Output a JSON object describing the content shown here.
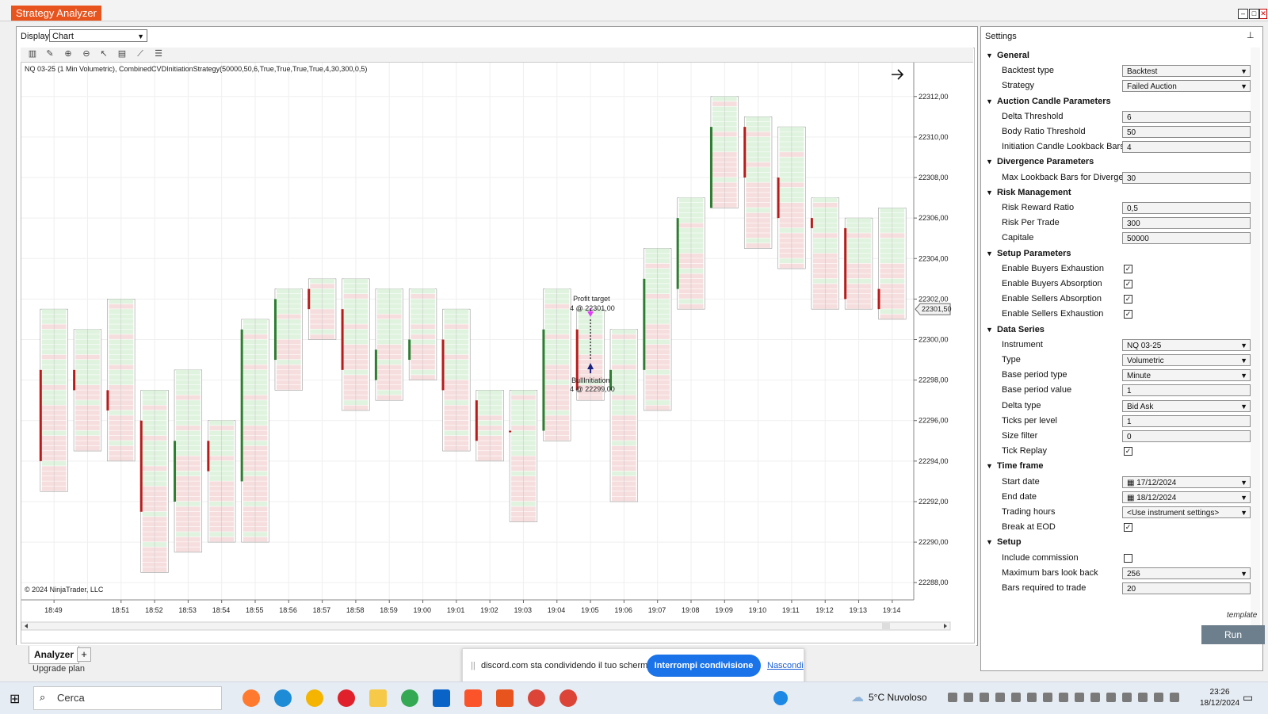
{
  "window": {
    "title": "Strategy Analyzer"
  },
  "display": {
    "label": "Display",
    "value": "Chart"
  },
  "chart": {
    "info": "NQ 03-25 (1 Min Volumetric), CombinedCVDInitiationStrategy(50000,50,6,True,True,True,True,4,30,300,0,5)",
    "copyright": "© 2024 NinjaTrader, LLC",
    "y_ticks": [
      "22312,00",
      "22310,00",
      "22308,00",
      "22306,00",
      "22304,00",
      "22302,00",
      "22300,00",
      "22298,00",
      "22296,00",
      "22294,00",
      "22292,00",
      "22290,00",
      "22288,00"
    ],
    "x_ticks": [
      "18:49",
      "18:51",
      "18:52",
      "18:53",
      "18:54",
      "18:55",
      "18:56",
      "18:57",
      "18:58",
      "18:59",
      "19:00",
      "19:01",
      "19:02",
      "19:03",
      "19:04",
      "19:05",
      "19:06",
      "19:07",
      "19:08",
      "19:09",
      "19:10",
      "19:11",
      "19:12",
      "19:13",
      "19:14"
    ],
    "price_marker": "22301,50",
    "profit_target": {
      "label": "Profit target",
      "detail": "4 @ 22301,00"
    },
    "bull_initiation": {
      "label": "BullInitiation",
      "detail": "4 @ 22299,00"
    },
    "colors": {
      "up": "#2e7d32",
      "down": "#b71c1c",
      "cell_green": "#dff3df",
      "cell_red": "#f7dede",
      "entry": "#1a237e",
      "target": "#e040fb"
    },
    "candles": [
      {
        "time": "18:49",
        "high": 22301.5,
        "low": 22292.5,
        "open": 22298.5,
        "close": 22294,
        "dir": "down"
      },
      {
        "time": "18:50",
        "high": 22300.5,
        "low": 22294.5,
        "open": 22298.5,
        "close": 22297.5,
        "dir": "down"
      },
      {
        "time": "18:51",
        "high": 22302,
        "low": 22294,
        "open": 22297.5,
        "close": 22296.5,
        "dir": "down"
      },
      {
        "time": "18:52",
        "high": 22297.5,
        "low": 22288.5,
        "open": 22296,
        "close": 22291.5,
        "dir": "down"
      },
      {
        "time": "18:53",
        "high": 22298.5,
        "low": 22289.5,
        "open": 22292,
        "close": 22295,
        "dir": "up"
      },
      {
        "time": "18:54",
        "high": 22296,
        "low": 22290,
        "open": 22295,
        "close": 22293.5,
        "dir": "down"
      },
      {
        "time": "18:55",
        "high": 22301,
        "low": 22290,
        "open": 22293,
        "close": 22300.5,
        "dir": "up"
      },
      {
        "time": "18:56",
        "high": 22302.5,
        "low": 22297.5,
        "open": 22299,
        "close": 22302,
        "dir": "up"
      },
      {
        "time": "18:57",
        "high": 22303,
        "low": 22300,
        "open": 22302.5,
        "close": 22301.5,
        "dir": "down"
      },
      {
        "time": "18:58",
        "high": 22303,
        "low": 22296.5,
        "open": 22301.5,
        "close": 22298.5,
        "dir": "down"
      },
      {
        "time": "18:59",
        "high": 22302.5,
        "low": 22297,
        "open": 22298,
        "close": 22299.5,
        "dir": "up"
      },
      {
        "time": "19:00",
        "high": 22302.5,
        "low": 22298,
        "open": 22299,
        "close": 22300,
        "dir": "up"
      },
      {
        "time": "19:01",
        "high": 22301.5,
        "low": 22294.5,
        "open": 22300,
        "close": 22297.5,
        "dir": "down"
      },
      {
        "time": "19:02",
        "high": 22297.5,
        "low": 22294,
        "open": 22297,
        "close": 22295,
        "dir": "down"
      },
      {
        "time": "19:03",
        "high": 22297.5,
        "low": 22291,
        "open": 22295.5,
        "close": 22295.5,
        "dir": "down"
      },
      {
        "time": "19:04",
        "high": 22302.5,
        "low": 22295,
        "open": 22295.5,
        "close": 22300.5,
        "dir": "up"
      },
      {
        "time": "19:05",
        "high": 22301.5,
        "low": 22297,
        "open": 22300.5,
        "close": 22297.5,
        "dir": "down"
      },
      {
        "time": "19:06",
        "high": 22300.5,
        "low": 22292,
        "open": 22297.5,
        "close": 22298.5,
        "dir": "up"
      },
      {
        "time": "19:07",
        "high": 22304.5,
        "low": 22296.5,
        "open": 22298.5,
        "close": 22303,
        "dir": "up"
      },
      {
        "time": "19:08",
        "high": 22307,
        "low": 22301.5,
        "open": 22302.5,
        "close": 22306,
        "dir": "up"
      },
      {
        "time": "19:09",
        "high": 22312,
        "low": 22306.5,
        "open": 22306.5,
        "close": 22310.5,
        "dir": "up"
      },
      {
        "time": "19:10",
        "high": 22311,
        "low": 22304.5,
        "open": 22310.5,
        "close": 22308,
        "dir": "down"
      },
      {
        "time": "19:11",
        "high": 22310.5,
        "low": 22303.5,
        "open": 22308,
        "close": 22306,
        "dir": "down"
      },
      {
        "time": "19:12",
        "high": 22307,
        "low": 22301.5,
        "open": 22306,
        "close": 22305.5,
        "dir": "down"
      },
      {
        "time": "19:13",
        "high": 22306,
        "low": 22301.5,
        "open": 22305.5,
        "close": 22302,
        "dir": "down"
      },
      {
        "time": "19:14",
        "high": 22306.5,
        "low": 22301,
        "open": 22302.5,
        "close": 22301.5,
        "dir": "down"
      }
    ]
  },
  "settings": {
    "title": "Settings",
    "template_label": "template",
    "run_label": "Run",
    "rows": [
      {
        "kind": "head",
        "label": "General"
      },
      {
        "kind": "drop",
        "label": "Backtest type",
        "value": "Backtest"
      },
      {
        "kind": "drop",
        "label": "Strategy",
        "value": "Failed Auction"
      },
      {
        "kind": "head",
        "label": "Auction Candle Parameters"
      },
      {
        "kind": "text",
        "label": "Delta Threshold",
        "value": "6"
      },
      {
        "kind": "text",
        "label": "Body Ratio Threshold",
        "value": "50"
      },
      {
        "kind": "text",
        "label": "Initiation Candle Lookback Bars",
        "value": "4"
      },
      {
        "kind": "head",
        "label": "Divergence Parameters"
      },
      {
        "kind": "text",
        "label": "Max Lookback Bars for Diverge...",
        "value": "30"
      },
      {
        "kind": "head",
        "label": "Risk Management"
      },
      {
        "kind": "text",
        "label": "Risk Reward Ratio",
        "value": "0,5"
      },
      {
        "kind": "text",
        "label": "Risk Per Trade",
        "value": "300"
      },
      {
        "kind": "text",
        "label": "Capitale",
        "value": "50000"
      },
      {
        "kind": "head",
        "label": "Setup Parameters"
      },
      {
        "kind": "check",
        "label": "Enable Buyers Exhaustion",
        "value": "✓"
      },
      {
        "kind": "check",
        "label": "Enable Buyers Absorption",
        "value": "✓"
      },
      {
        "kind": "check",
        "label": "Enable Sellers Absorption",
        "value": "✓"
      },
      {
        "kind": "check",
        "label": "Enable Sellers Exhaustion",
        "value": "✓"
      },
      {
        "kind": "head",
        "label": "Data Series"
      },
      {
        "kind": "drop",
        "label": "Instrument",
        "value": "NQ 03-25"
      },
      {
        "kind": "drop",
        "label": "Type",
        "value": "Volumetric"
      },
      {
        "kind": "drop",
        "label": "Base period type",
        "value": "Minute"
      },
      {
        "kind": "text",
        "label": "Base period value",
        "value": "1"
      },
      {
        "kind": "drop",
        "label": "Delta type",
        "value": "Bid Ask"
      },
      {
        "kind": "text",
        "label": "Ticks per level",
        "value": "1"
      },
      {
        "kind": "text",
        "label": "Size filter",
        "value": "0"
      },
      {
        "kind": "check",
        "label": "Tick Replay",
        "value": "✓"
      },
      {
        "kind": "head",
        "label": "Time frame"
      },
      {
        "kind": "date",
        "label": "Start date",
        "value": "17/12/2024"
      },
      {
        "kind": "date",
        "label": "End date",
        "value": "18/12/2024"
      },
      {
        "kind": "drop",
        "label": "Trading hours",
        "value": "<Use instrument settings>"
      },
      {
        "kind": "check",
        "label": "Break at EOD",
        "value": "✓"
      },
      {
        "kind": "head",
        "label": "Setup"
      },
      {
        "kind": "check",
        "label": "Include commission",
        "value": ""
      },
      {
        "kind": "drop",
        "label": "Maximum bars look back",
        "value": "256"
      },
      {
        "kind": "text",
        "label": "Bars required to trade",
        "value": "20"
      }
    ]
  },
  "tabs": {
    "active": "Analyzer",
    "add": "+"
  },
  "upgrade": "Upgrade plan",
  "share": {
    "message": "discord.com sta condividendo il tuo schermo.",
    "stop": "Interrompi condivisione",
    "hide": "Nascondi"
  },
  "taskbar": {
    "search": "Cerca",
    "weather": "5°C  Nuvoloso",
    "time": "23:26",
    "date": "18/12/2024"
  }
}
